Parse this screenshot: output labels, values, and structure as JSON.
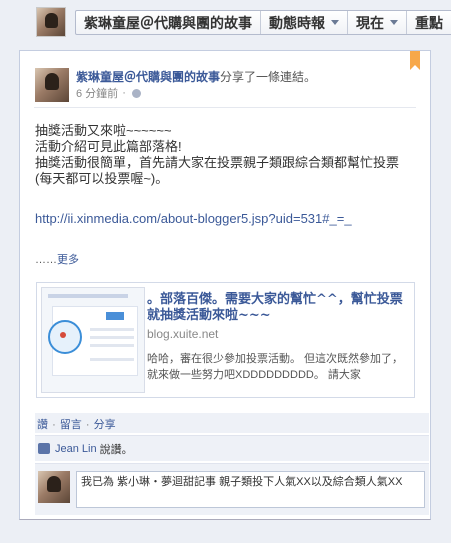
{
  "header": {
    "crumbs": [
      {
        "label": "紫琳童屋＠代購與團的故事",
        "has_caret": false
      },
      {
        "label": "動態時報",
        "has_caret": true
      },
      {
        "label": "現在",
        "has_caret": true
      },
      {
        "label": "重點",
        "has_caret": false
      }
    ]
  },
  "post": {
    "author": "紫琳童屋＠代購與團的故事",
    "action": "分享了一條連結。",
    "timestamp": "6 分鐘前",
    "body_lines": [
      "抽獎活動又來啦~~~~~~",
      "活動介紹可見此篇部落格!",
      "抽獎活動很簡單，首先請大家在投票親子類跟綜合類都幫忙投票(每天都可以投票喔~)。"
    ],
    "link": "http://ii.xinmedia.com/about-blogger5.jsp?uid=531#_=_",
    "more_prefix": "……",
    "more_label": "更多",
    "attachment": {
      "title": "。部落百傑。需要大家的幫忙^^，幫忙投票就抽獎活動來啦~~~",
      "domain": "blog.xuite.net",
      "description": "哈哈，審在很少參加投票活動。 但這次既然參加了，就來做一些努力吧XDDDDDDDDD。 請大家"
    },
    "actions": {
      "like": "讚",
      "comment": "留言",
      "share": "分享",
      "separator": "·"
    },
    "likes": {
      "name": "Jean Lin",
      "suffix": "說讚。"
    },
    "comment_text": "我已為 紫小琳・夢迴甜記事 親子類投下人氣XX以及綜合類人氣XX"
  }
}
